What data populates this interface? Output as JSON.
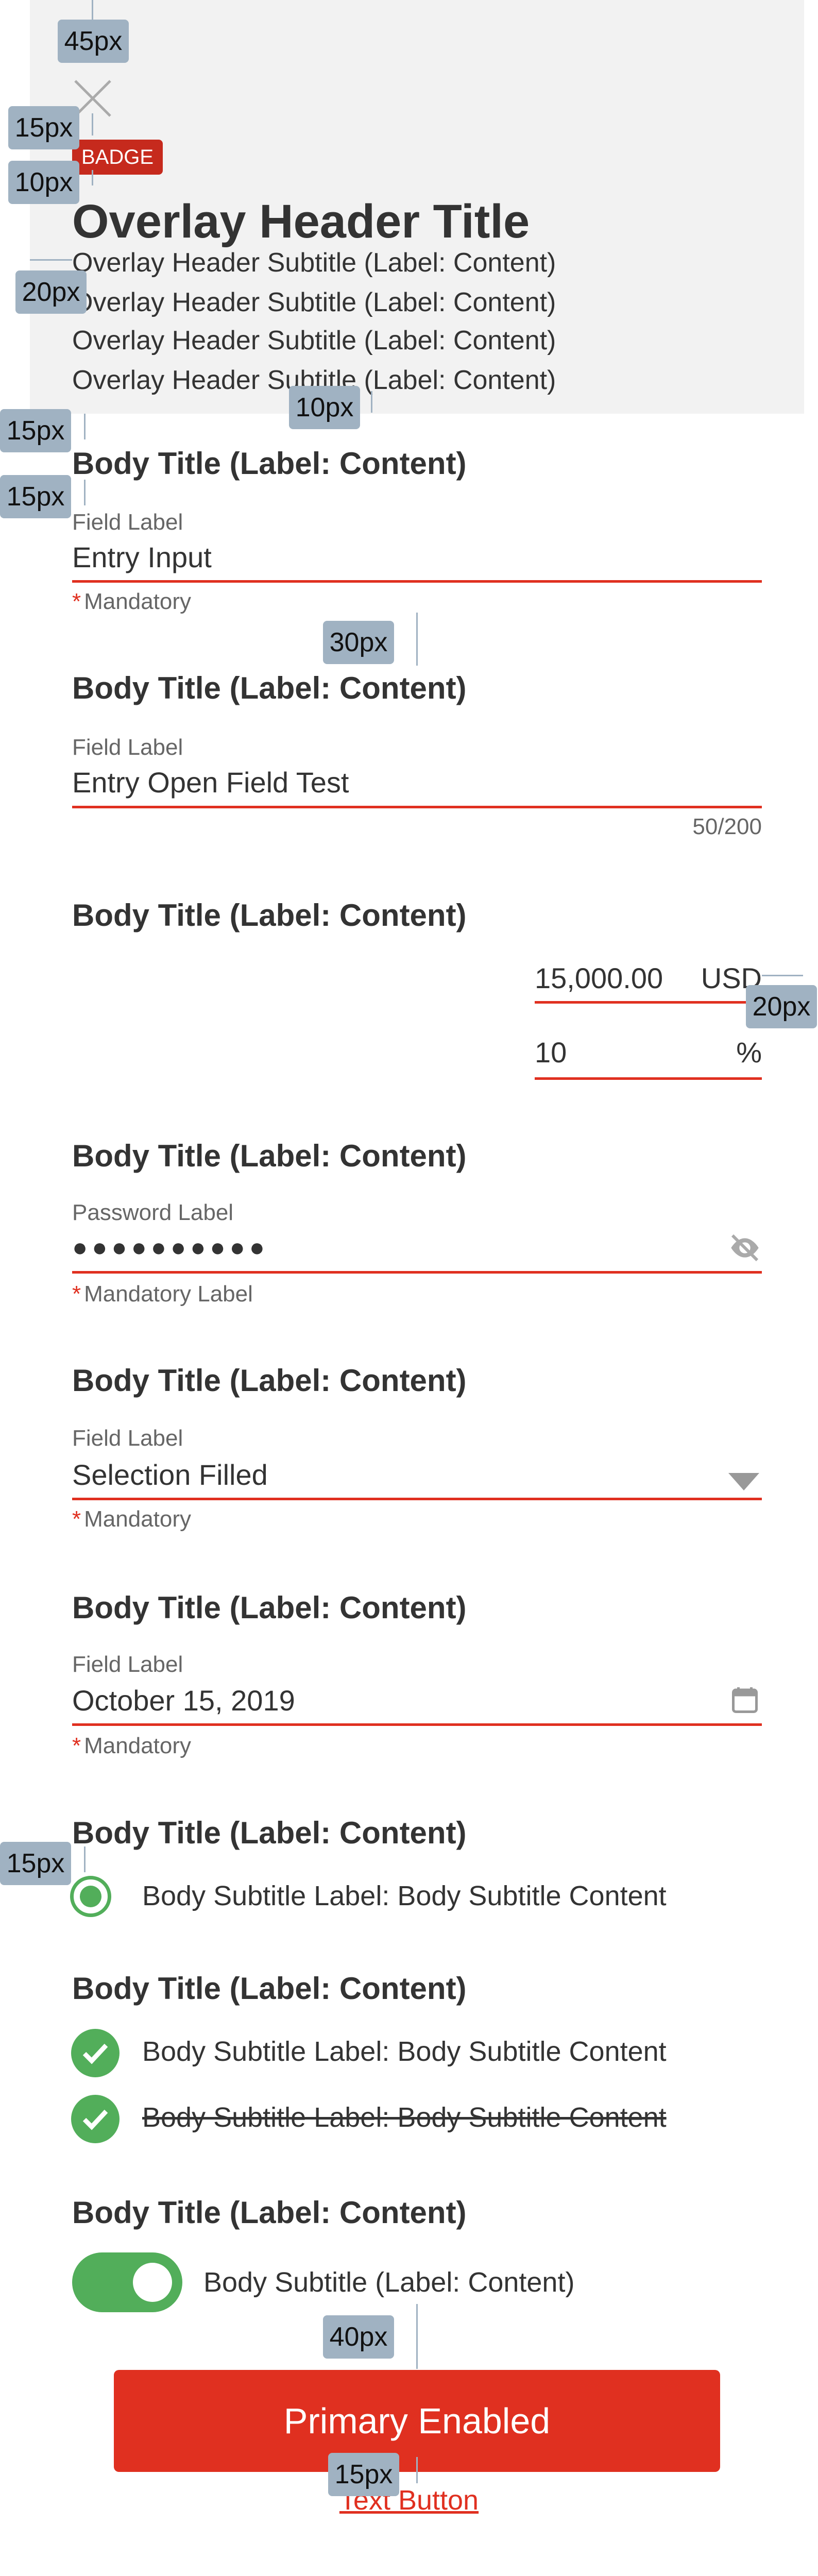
{
  "header": {
    "badge": "BADGE",
    "title": "Overlay Header Title",
    "subtitles": [
      "Overlay Header Subtitle (Label: Content)",
      "Overlay Header Subtitle (Label: Content)",
      "Overlay Header Subtitle (Label: Content)",
      "Overlay Header Subtitle (Label: Content)"
    ],
    "close_icon": "close-icon"
  },
  "sections": {
    "entry": {
      "title": "Body Title (Label: Content)",
      "label": "Field Label",
      "value": "Entry Input",
      "helper": "Mandatory"
    },
    "open": {
      "title": "Body Title (Label: Content)",
      "label": "Field Label",
      "value": "Entry Open Field Test",
      "counter": "50/200"
    },
    "amount": {
      "title": "Body Title (Label: Content)",
      "amount": "15,000.00",
      "currency": "USD",
      "percent": "10",
      "percent_unit": "%"
    },
    "password": {
      "title": "Body Title (Label: Content)",
      "label": "Password Label",
      "value": "●●●●●●●●●●",
      "helper": "Mandatory Label",
      "icon": "eye-off-icon"
    },
    "select": {
      "title": "Body Title (Label: Content)",
      "label": "Field Label",
      "value": "Selection Filled",
      "helper": "Mandatory",
      "icon": "caret-down-icon"
    },
    "date": {
      "title": "Body Title (Label: Content)",
      "label": "Field Label",
      "value": "October 15, 2019",
      "helper": "Mandatory",
      "icon": "calendar-icon"
    },
    "radio": {
      "title": "Body Title (Label: Content)",
      "option": "Body Subtitle Label: Body Subtitle Content",
      "selected": true
    },
    "checks": {
      "title": "Body Title (Label: Content)",
      "items": [
        {
          "label": "Body Subtitle Label: Body Subtitle Content",
          "checked": true,
          "strikethrough": false
        },
        {
          "label": "Body Subtitle Label: Body Subtitle Content",
          "checked": true,
          "strikethrough": true
        }
      ]
    },
    "toggle": {
      "title": "Body Title (Label: Content)",
      "label": "Body Subtitle (Label: Content)",
      "on": true
    }
  },
  "actions": {
    "primary": "Primary Enabled",
    "text_button": "Text Button"
  },
  "annotations": [
    "45px",
    "15px",
    "10px",
    "20px",
    "10px",
    "15px",
    "15px",
    "30px",
    "20px",
    "15px",
    "40px",
    "15px"
  ],
  "colors": {
    "accent": "#e03020",
    "badge": "#c62a1d",
    "success": "#52ae5a",
    "header_bg": "#f2f2f2",
    "annotation": "#a0b2c2"
  }
}
